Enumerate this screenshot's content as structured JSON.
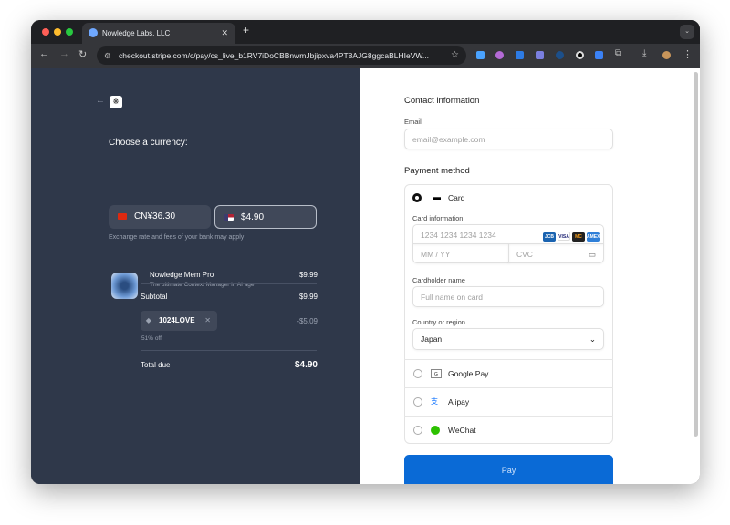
{
  "browser": {
    "tab_title": "Nowledge Labs, LLC",
    "url": "checkout.stripe.com/c/pay/cs_live_b1RV7iDoCBBnwmJbjipxva4PT8AJG8ggcaBLHIeVW..."
  },
  "summary": {
    "currency_heading": "Choose a currency:",
    "currencies": [
      {
        "label": "CN¥36.30",
        "selected": false
      },
      {
        "label": "$4.90",
        "selected": true
      }
    ],
    "exchange_note": "Exchange rate and fees of your bank may apply",
    "product": {
      "name": "Nowledge Mem Pro",
      "description": "The ultimate Context Manager in AI age",
      "price": "$9.99"
    },
    "subtotal_label": "Subtotal",
    "subtotal": "$9.99",
    "promo_code": "1024LOVE",
    "discount": "-$5.09",
    "discount_note": "51% off",
    "total_label": "Total due",
    "total": "$4.90"
  },
  "form": {
    "contact_heading": "Contact information",
    "email_label": "Email",
    "email_placeholder": "email@example.com",
    "payment_heading": "Payment method",
    "card_label": "Card",
    "card_info_label": "Card information",
    "card_number_placeholder": "1234 1234 1234 1234",
    "expiry_placeholder": "MM / YY",
    "cvc_placeholder": "CVC",
    "cardholder_label": "Cardholder name",
    "cardholder_placeholder": "Full name on card",
    "country_label": "Country or region",
    "country_value": "Japan",
    "methods": [
      "Google Pay",
      "Alipay",
      "WeChat"
    ],
    "pay_button": "Pay",
    "card_brands": [
      "JCB",
      "VISA",
      "MC",
      "AMEX"
    ]
  },
  "colors": {
    "panel": "#2f384a",
    "pay": "#0a6ad6"
  }
}
